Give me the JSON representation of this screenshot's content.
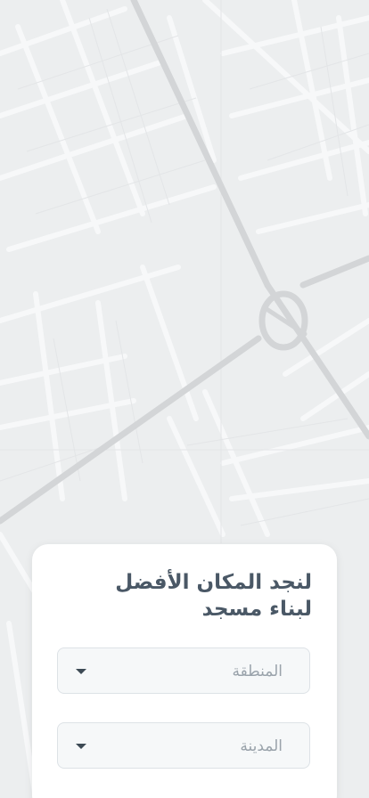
{
  "card": {
    "title_line1": "لنجد المكان الأفضل",
    "title_line2": "لبناء مسجد"
  },
  "form": {
    "region_placeholder": "المنطقة",
    "city_placeholder": "المدينة"
  },
  "icons": {
    "dropdown": "caret-down-icon"
  },
  "colors": {
    "map_background": "#eceeef",
    "major_road": "#d2d4d6",
    "title_text": "#4a5866",
    "placeholder_text": "#9aa3ab",
    "field_border": "#dde2e6"
  }
}
